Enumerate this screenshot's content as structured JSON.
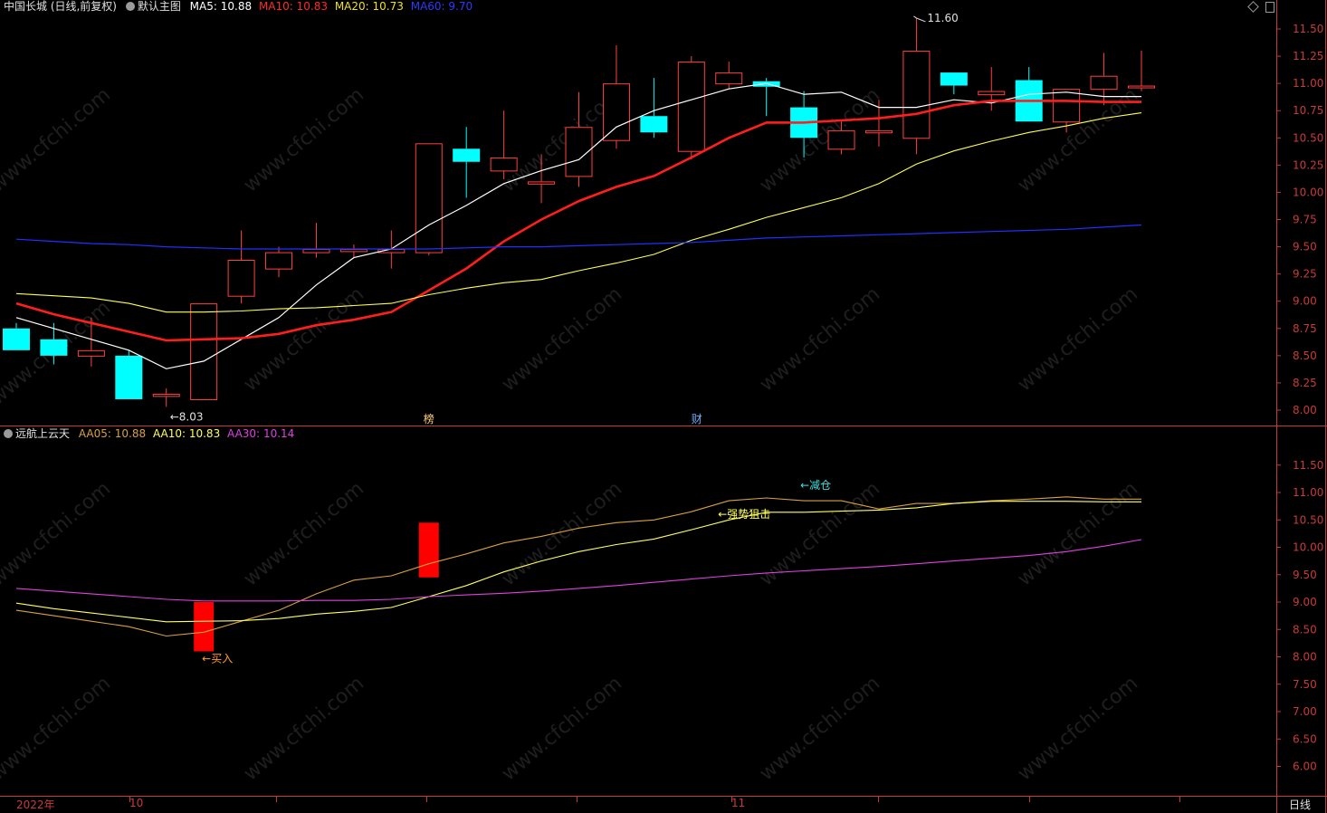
{
  "main_header": {
    "stock": "中国长城 (日线,前复权)",
    "panel": "默认主图",
    "ma5_label": "MA5:",
    "ma5": "10.88",
    "ma10_label": "MA10:",
    "ma10": "10.83",
    "ma20_label": "MA20:",
    "ma20": "10.73",
    "ma60_label": "MA60:",
    "ma60": "9.70"
  },
  "sub_header": {
    "indicator": "远航上云天",
    "aa05_label": "AA05:",
    "aa05": "10.88",
    "aa10_label": "AA10:",
    "aa10": "10.83",
    "aa30_label": "AA30:",
    "aa30": "10.14"
  },
  "colors": {
    "up": "#ff4040",
    "down": "#00ffff",
    "ma5": "#ffffff",
    "ma10": "#ff1e1e",
    "ma20": "#ffff55",
    "ma60": "#2030ff",
    "aa05": "#d8a040",
    "aa10": "#ffff60",
    "aa30": "#e040e0",
    "axis": "#c83a3a",
    "buy_bar": "#ff0000"
  },
  "markers": {
    "low_label": "←8.03",
    "high_label": "11.60",
    "event1": "榜",
    "event2": "财",
    "buy": "←买入",
    "strong": "←强势狙击",
    "reduce": "←减仓"
  },
  "bottom": {
    "year": "2022年",
    "m10": "10",
    "m11": "11",
    "period": "日线"
  },
  "watermark": "www.cfchi.com",
  "chart_data": [
    {
      "type": "candlestick",
      "title": "中国长城 (日线,前复权)",
      "ylim": [
        8.0,
        11.5
      ],
      "yticks": [
        "11.50",
        "11.25",
        "11.00",
        "10.75",
        "10.50",
        "10.25",
        "10.00",
        "9.75",
        "9.50",
        "9.25",
        "9.00",
        "8.75",
        "8.50",
        "8.25",
        "8.00"
      ],
      "candles": [
        {
          "o": 8.75,
          "h": 8.8,
          "l": 8.55,
          "c": 8.55
        },
        {
          "o": 8.65,
          "h": 8.8,
          "l": 8.42,
          "c": 8.5
        },
        {
          "o": 8.5,
          "h": 8.85,
          "l": 8.4,
          "c": 8.55
        },
        {
          "o": 8.5,
          "h": 8.55,
          "l": 8.1,
          "c": 8.1
        },
        {
          "o": 8.13,
          "h": 8.2,
          "l": 8.03,
          "c": 8.15
        },
        {
          "o": 8.1,
          "h": 8.98,
          "l": 8.1,
          "c": 8.98
        },
        {
          "o": 9.05,
          "h": 9.65,
          "l": 8.98,
          "c": 9.38
        },
        {
          "o": 9.3,
          "h": 9.5,
          "l": 9.22,
          "c": 9.45
        },
        {
          "o": 9.45,
          "h": 9.72,
          "l": 9.4,
          "c": 9.48
        },
        {
          "o": 9.46,
          "h": 9.52,
          "l": 9.4,
          "c": 9.48
        },
        {
          "o": 9.45,
          "h": 9.65,
          "l": 9.3,
          "c": 9.48
        },
        {
          "o": 9.45,
          "h": 10.45,
          "l": 9.42,
          "c": 10.45
        },
        {
          "o": 10.4,
          "h": 10.6,
          "l": 9.95,
          "c": 10.28
        },
        {
          "o": 10.2,
          "h": 10.75,
          "l": 10.12,
          "c": 10.32
        },
        {
          "o": 10.08,
          "h": 10.35,
          "l": 9.9,
          "c": 10.1
        },
        {
          "o": 10.15,
          "h": 10.92,
          "l": 10.05,
          "c": 10.6
        },
        {
          "o": 10.48,
          "h": 11.35,
          "l": 10.4,
          "c": 11.0
        },
        {
          "o": 10.7,
          "h": 11.05,
          "l": 10.5,
          "c": 10.55
        },
        {
          "o": 10.38,
          "h": 11.25,
          "l": 10.3,
          "c": 11.2
        },
        {
          "o": 11.0,
          "h": 11.2,
          "l": 10.95,
          "c": 11.1
        },
        {
          "o": 11.02,
          "h": 11.05,
          "l": 10.7,
          "c": 10.97
        },
        {
          "o": 10.78,
          "h": 10.93,
          "l": 10.32,
          "c": 10.5
        },
        {
          "o": 10.4,
          "h": 10.65,
          "l": 10.35,
          "c": 10.57
        },
        {
          "o": 10.55,
          "h": 10.85,
          "l": 10.42,
          "c": 10.57
        },
        {
          "o": 10.5,
          "h": 11.6,
          "l": 10.35,
          "c": 11.3
        },
        {
          "o": 11.1,
          "h": 11.1,
          "l": 10.9,
          "c": 10.98
        },
        {
          "o": 10.9,
          "h": 11.15,
          "l": 10.75,
          "c": 10.93
        },
        {
          "o": 11.03,
          "h": 11.15,
          "l": 10.65,
          "c": 10.65
        },
        {
          "o": 10.65,
          "h": 10.95,
          "l": 10.55,
          "c": 10.95
        },
        {
          "o": 10.95,
          "h": 11.28,
          "l": 10.8,
          "c": 11.07
        },
        {
          "o": 10.98,
          "h": 11.3,
          "l": 10.93,
          "c": 10.98
        }
      ],
      "series": [
        {
          "name": "MA5",
          "values": [
            8.85,
            8.75,
            8.65,
            8.55,
            8.38,
            8.45,
            8.65,
            8.85,
            9.15,
            9.4,
            9.48,
            9.7,
            9.88,
            10.08,
            10.2,
            10.3,
            10.6,
            10.75,
            10.85,
            10.95,
            11.0,
            10.9,
            10.92,
            10.78,
            10.78,
            10.85,
            10.82,
            10.9,
            10.92,
            10.88,
            10.88
          ]
        },
        {
          "name": "MA10",
          "values": [
            8.98,
            8.88,
            8.8,
            8.72,
            8.64,
            8.65,
            8.66,
            8.7,
            8.78,
            8.83,
            8.9,
            9.1,
            9.3,
            9.55,
            9.75,
            9.92,
            10.05,
            10.15,
            10.32,
            10.5,
            10.64,
            10.64,
            10.66,
            10.68,
            10.72,
            10.8,
            10.84,
            10.84,
            10.84,
            10.83,
            10.83
          ]
        },
        {
          "name": "MA20",
          "values": [
            9.07,
            9.05,
            9.03,
            8.98,
            8.9,
            8.9,
            8.91,
            8.93,
            8.94,
            8.96,
            8.98,
            9.06,
            9.12,
            9.17,
            9.2,
            9.28,
            9.35,
            9.43,
            9.56,
            9.66,
            9.77,
            9.86,
            9.95,
            10.08,
            10.26,
            10.38,
            10.47,
            10.55,
            10.61,
            10.68,
            10.73
          ]
        },
        {
          "name": "MA60",
          "values": [
            9.57,
            9.55,
            9.53,
            9.52,
            9.5,
            9.49,
            9.48,
            9.48,
            9.48,
            9.48,
            9.48,
            9.48,
            9.49,
            9.5,
            9.5,
            9.51,
            9.52,
            9.53,
            9.54,
            9.56,
            9.58,
            9.59,
            9.6,
            9.61,
            9.62,
            9.63,
            9.64,
            9.65,
            9.66,
            9.68,
            9.7
          ]
        }
      ]
    },
    {
      "type": "line",
      "title": "远航上云天",
      "ylim": [
        5.75,
        12.0
      ],
      "yticks": [
        "11.50",
        "11.00",
        "10.50",
        "10.00",
        "9.50",
        "9.00",
        "8.50",
        "8.00",
        "7.50",
        "7.00",
        "6.50",
        "6.00"
      ],
      "series": [
        {
          "name": "AA05",
          "values": [
            8.85,
            8.75,
            8.65,
            8.55,
            8.38,
            8.45,
            8.65,
            8.85,
            9.15,
            9.4,
            9.48,
            9.7,
            9.88,
            10.08,
            10.2,
            10.35,
            10.45,
            10.5,
            10.65,
            10.85,
            10.9,
            10.85,
            10.85,
            10.7,
            10.8,
            10.8,
            10.85,
            10.88,
            10.92,
            10.88,
            10.88
          ]
        },
        {
          "name": "AA10",
          "values": [
            8.98,
            8.88,
            8.8,
            8.72,
            8.64,
            8.65,
            8.66,
            8.7,
            8.78,
            8.83,
            8.9,
            9.1,
            9.3,
            9.55,
            9.75,
            9.92,
            10.05,
            10.15,
            10.32,
            10.5,
            10.64,
            10.64,
            10.66,
            10.68,
            10.72,
            10.8,
            10.84,
            10.84,
            10.84,
            10.83,
            10.83
          ]
        },
        {
          "name": "AA30",
          "values": [
            9.25,
            9.2,
            9.15,
            9.1,
            9.05,
            9.02,
            9.02,
            9.02,
            9.03,
            9.03,
            9.05,
            9.1,
            9.13,
            9.16,
            9.2,
            9.25,
            9.3,
            9.36,
            9.42,
            9.48,
            9.53,
            9.57,
            9.61,
            9.65,
            9.7,
            9.75,
            9.8,
            9.85,
            9.92,
            10.02,
            10.14
          ]
        }
      ],
      "signal_bars": [
        {
          "index": 5,
          "from": 8.1,
          "to": 9.0
        },
        {
          "index": 11,
          "from": 9.45,
          "to": 10.45
        }
      ]
    }
  ]
}
